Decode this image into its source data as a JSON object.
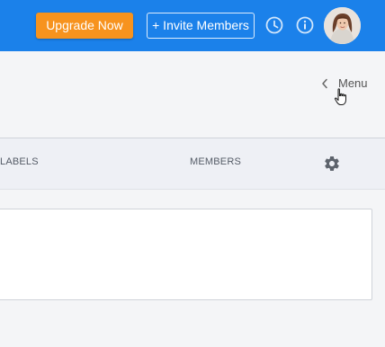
{
  "header": {
    "upgrade_label": "Upgrade Now",
    "invite_label": "+ Invite Members",
    "icons": [
      "clock-icon",
      "info-icon",
      "user-avatar"
    ]
  },
  "subheader": {
    "menu_label": "Menu"
  },
  "tabs": {
    "labels_label": "LABELS",
    "members_label": "MEMBERS",
    "settings_icon": "gear-icon"
  },
  "colors": {
    "topbar": "#1b81ea",
    "upgrade": "#f7931e"
  }
}
